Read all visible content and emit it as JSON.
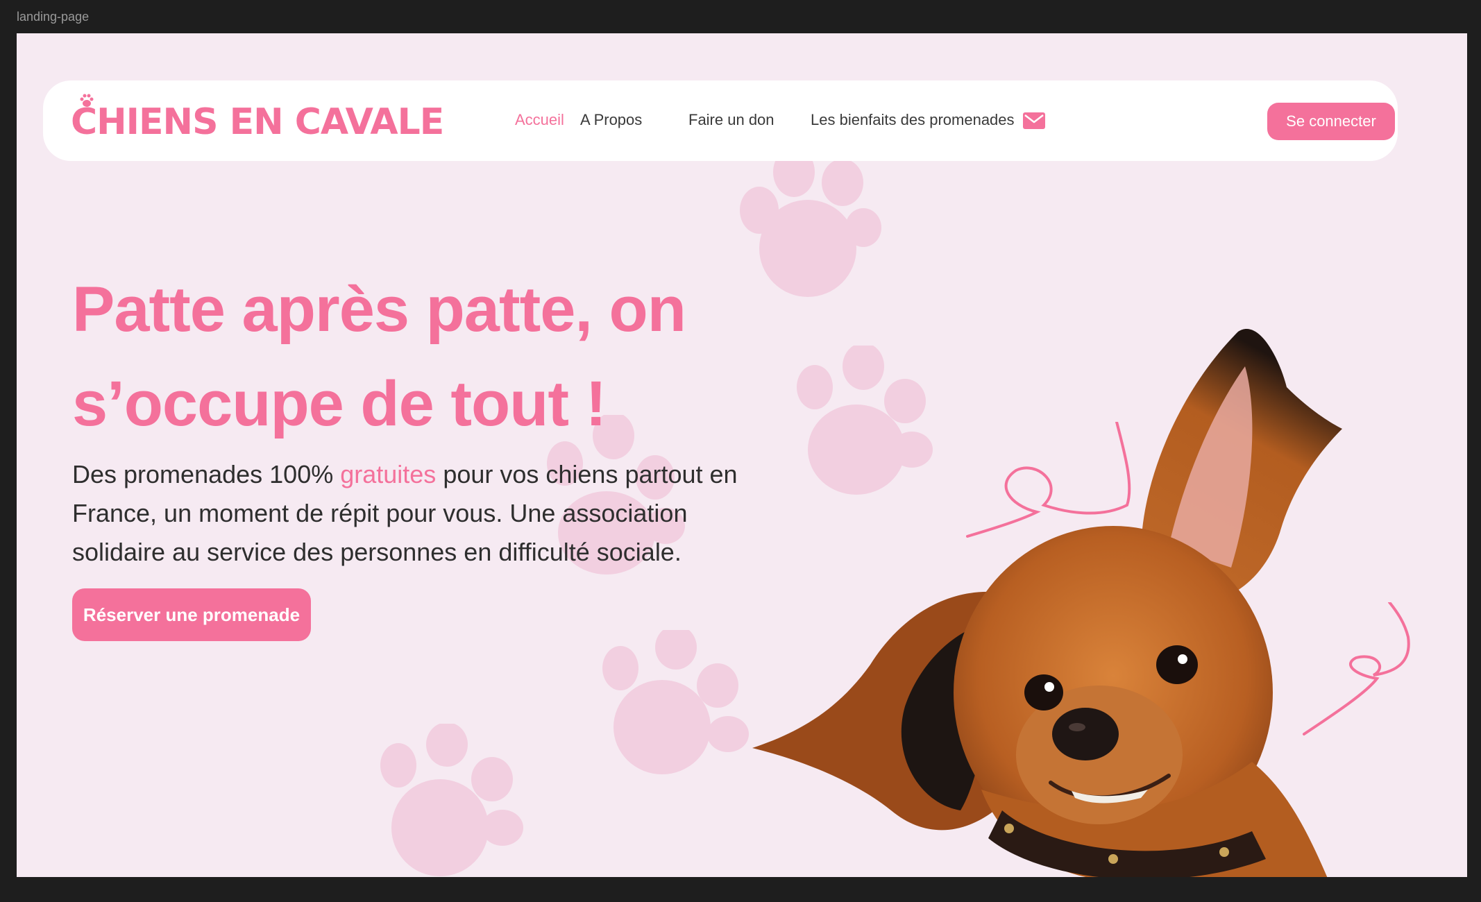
{
  "frame": {
    "label": "landing-page"
  },
  "brand": {
    "logo_text": "CHIENS EN CAVALE",
    "accent_color": "#f4719b",
    "background_color": "#f6eaf2"
  },
  "nav": {
    "links": [
      {
        "label": "Accueil",
        "active": true
      },
      {
        "label": "A Propos",
        "active": false
      },
      {
        "label": "Faire un don",
        "active": false
      },
      {
        "label": "Les bienfaits des promenades",
        "active": false
      }
    ],
    "contact_icon": "mail-icon",
    "login_label": "Se connecter"
  },
  "hero": {
    "headline_part1": "Patte après patte, on s’occupe de ",
    "headline_emphasis": "tout !",
    "subtext_before": "Des promenades 100% ",
    "subtext_highlight": "gratuites",
    "subtext_after": " pour vos chiens partout en France, un moment de répit pour vous. Une association solidaire au service des personnes en difficulté sociale.",
    "cta_label": "Réserver une promenade"
  }
}
